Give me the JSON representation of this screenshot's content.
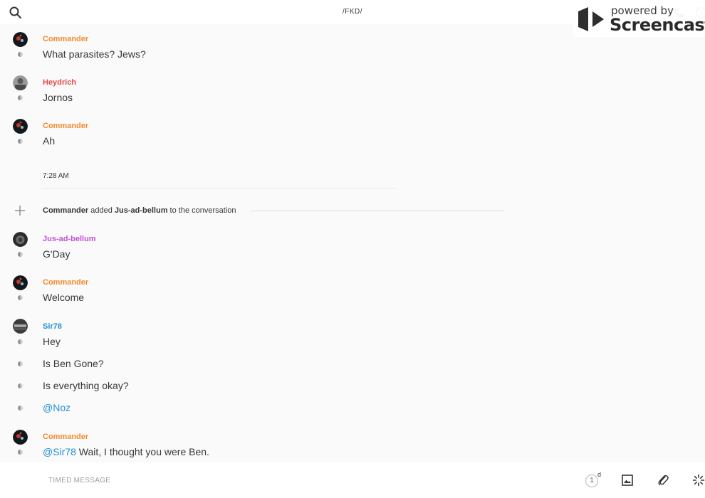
{
  "header": {
    "title": "/FKD/"
  },
  "watermark": {
    "small": "powered by",
    "big": "Screencastify"
  },
  "colors": {
    "commander": "#f28a2e",
    "heydrich": "#e8484d",
    "jus_ad_bellum": "#c34fd6",
    "sir78": "#2391d3",
    "mention": "#2391d3"
  },
  "messages": [
    {
      "sender": "Commander",
      "text": "What parasites? Jews?"
    },
    {
      "sender": "Heydrich",
      "text": "Jornos"
    },
    {
      "sender": "Commander",
      "text": "Ah"
    }
  ],
  "timestamp": "7:28 AM",
  "system": {
    "actor": "Commander",
    "verb": "added",
    "target": "Jus-ad-bellum",
    "suffix": "to the conversation"
  },
  "messages2": [
    {
      "sender": "Jus-ad-bellum",
      "text": "G'Day"
    },
    {
      "sender": "Commander",
      "text": "Welcome"
    },
    {
      "sender": "Sir78",
      "texts": [
        "Hey",
        "Is Ben Gone?",
        "Is everything okay?",
        "@Noz"
      ]
    },
    {
      "sender": "Commander",
      "mention": "@Sir78",
      "text": "Wait, I thought you were Ben."
    }
  ],
  "footer": {
    "placeholder": "TIMED MESSAGE",
    "timer_value": "1",
    "timer_unit": "d"
  },
  "icons": {
    "search": "search-icon",
    "call": "phone-icon",
    "info": "info-icon",
    "add": "plus-icon",
    "image": "image-icon",
    "attach": "paperclip-icon",
    "ping": "ping-icon"
  }
}
